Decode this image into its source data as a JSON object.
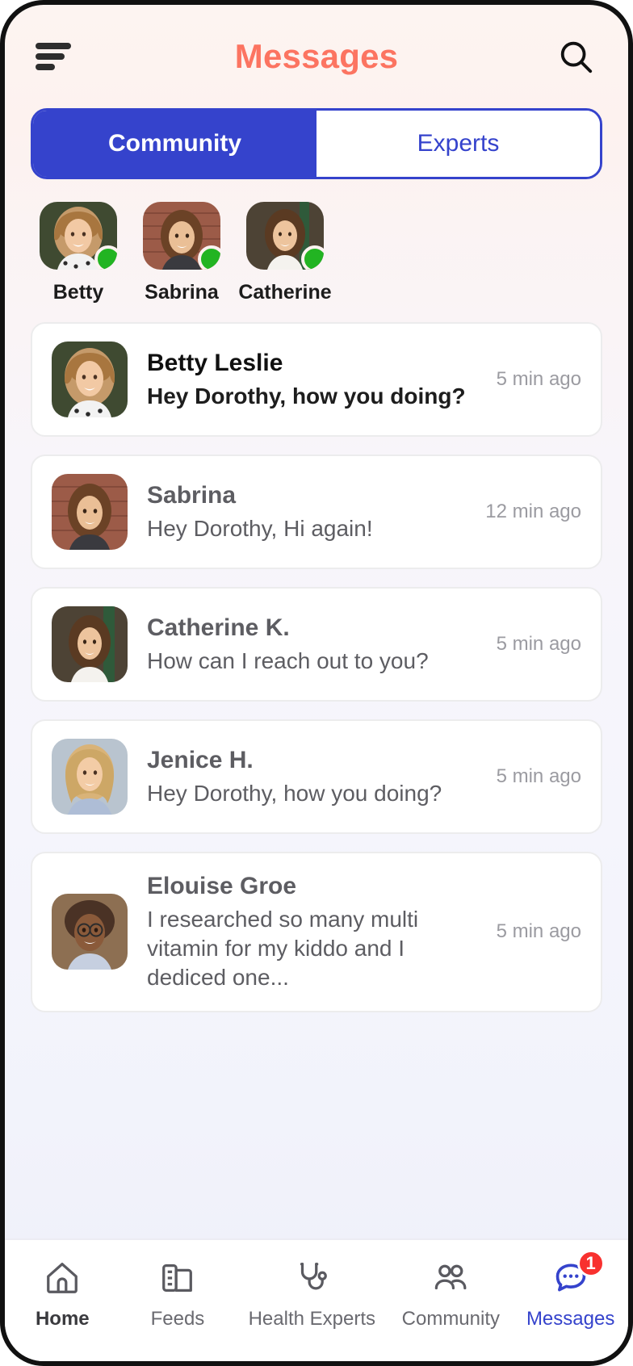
{
  "header": {
    "menu_icon": "hamburger-icon",
    "title": "Messages",
    "search_icon": "search-icon",
    "title_color": "#fc7461"
  },
  "tabs": {
    "accent_color": "#3543cc",
    "items": [
      {
        "label": "Community",
        "active": true
      },
      {
        "label": "Experts",
        "active": false
      }
    ]
  },
  "stories": {
    "online_color": "#22b422",
    "items": [
      {
        "name": "Betty",
        "online": true,
        "avatar": "woman-blonde-polka-dot-top"
      },
      {
        "name": "Sabrina",
        "online": true,
        "avatar": "woman-brunette-brick-wall"
      },
      {
        "name": "Catherine",
        "online": true,
        "avatar": "woman-curly-white-top"
      }
    ]
  },
  "conversations": [
    {
      "name": "Betty Leslie",
      "message": "Hey Dorothy, how you doing?",
      "time": "5 min ago",
      "unread": true,
      "avatar": "woman-blonde-polka-dot-top"
    },
    {
      "name": "Sabrina",
      "message": "Hey Dorothy, Hi again!",
      "time": "12 min ago",
      "unread": false,
      "avatar": "woman-brunette-brick-wall"
    },
    {
      "name": "Catherine K.",
      "message": "How can I reach out to you?",
      "time": "5 min ago",
      "unread": false,
      "avatar": "woman-curly-white-top"
    },
    {
      "name": "Jenice H.",
      "message": "Hey Dorothy, how you doing?",
      "time": "5 min ago",
      "unread": false,
      "avatar": "woman-blonde-blue-shirt"
    },
    {
      "name": "Elouise Groe",
      "message": "I researched so many multi vitamin for my kiddo and I dediced one...",
      "time": "5 min ago",
      "unread": false,
      "avatar": "woman-glasses-curly-hair"
    }
  ],
  "bottom_nav": {
    "active_color": "#3543cc",
    "badge_color": "#f8312f",
    "items": [
      {
        "label": "Home",
        "icon": "home-icon",
        "active": false,
        "badge": null
      },
      {
        "label": "Feeds",
        "icon": "feeds-icon",
        "active": false,
        "badge": null
      },
      {
        "label": "Health Experts",
        "icon": "stethoscope-icon",
        "active": false,
        "badge": null
      },
      {
        "label": "Community",
        "icon": "people-icon",
        "active": false,
        "badge": null
      },
      {
        "label": "Messages",
        "icon": "chat-bubble-icon",
        "active": true,
        "badge": "1"
      }
    ]
  }
}
